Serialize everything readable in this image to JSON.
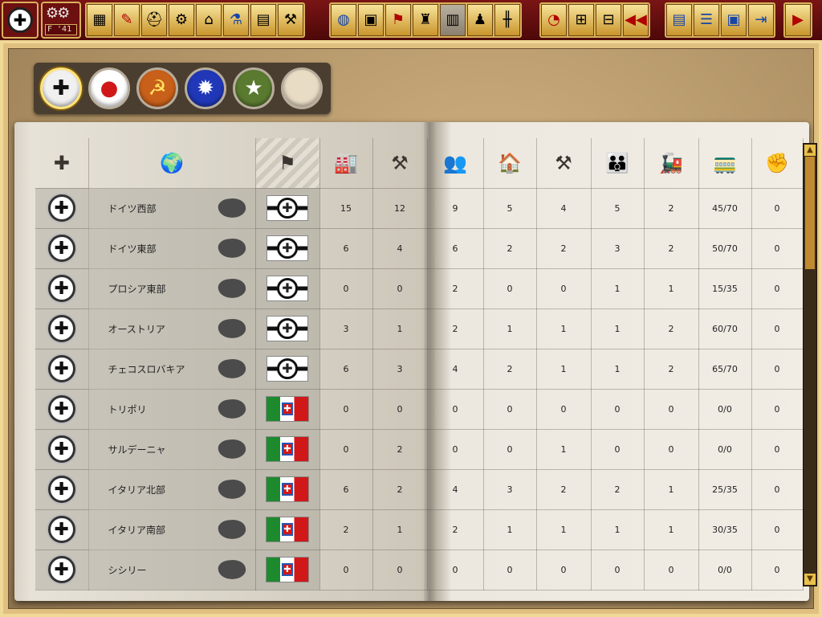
{
  "toolbar": {
    "main_icon": "balkenkreuz-icon",
    "date_label": "F '41",
    "icons": [
      "map-grid-icon",
      "production-icon",
      "helmet-icon",
      "tank-icon",
      "factory-icon",
      "research-icon",
      "building-icon",
      "tools-icon",
      "globe-icon",
      "document-globe-icon",
      "diplomacy-flag-icon",
      "army-icon",
      "industry-dim-icon",
      "troops-icon",
      "railroad-icon",
      "pie-chart-icon",
      "table-add-icon",
      "table-icon",
      "rewind-icon",
      "report-icon",
      "list-icon",
      "save-icon",
      "exit-icon",
      "next-icon"
    ]
  },
  "nations": [
    {
      "id": "germany",
      "symbol": "✚",
      "bg": "#f0f0f0",
      "fg": "#111111",
      "selected": true
    },
    {
      "id": "japan",
      "symbol": "●",
      "bg": "#ffffff",
      "fg": "#d01818"
    },
    {
      "id": "ussr",
      "symbol": "☭",
      "bg": "#c8601a",
      "fg": "#ffe060"
    },
    {
      "id": "china",
      "symbol": "✹",
      "bg": "#2038b8",
      "fg": "#ffffff"
    },
    {
      "id": "usa",
      "symbol": "★",
      "bg": "#5a7a30",
      "fg": "#ffffff"
    },
    {
      "id": "neutral",
      "symbol": "",
      "bg": "#e8dcc4",
      "fg": "#000000"
    }
  ],
  "header_icons": [
    "owner-icon",
    "world-map-icon",
    "flag-icon",
    "industry-icon",
    "resources-icon",
    "manpower-icon",
    "factory-small-icon",
    "pickaxe-hammer-icon",
    "people-icon",
    "train-icon",
    "transport-capacity-icon",
    "resistance-icon"
  ],
  "header_glyphs": [
    "✚",
    "🌍",
    "⚑",
    "🏭",
    "⚒",
    "👥",
    "🏠",
    "⚒",
    "👪",
    "🚂",
    "🚃",
    "✊"
  ],
  "regions": [
    {
      "name": "ドイツ西部",
      "flag": "de",
      "ic": "15",
      "res": "12",
      "mp": "9",
      "fac": "5",
      "mine": "4",
      "pop": "5",
      "rail": "2",
      "trans": "45/70",
      "resist": "0"
    },
    {
      "name": "ドイツ東部",
      "flag": "de",
      "ic": "6",
      "res": "4",
      "mp": "6",
      "fac": "2",
      "mine": "2",
      "pop": "3",
      "rail": "2",
      "trans": "50/70",
      "resist": "0"
    },
    {
      "name": "プロシア東部",
      "flag": "de",
      "ic": "0",
      "res": "0",
      "mp": "2",
      "fac": "0",
      "mine": "0",
      "pop": "1",
      "rail": "1",
      "trans": "15/35",
      "resist": "0"
    },
    {
      "name": "オーストリア",
      "flag": "de",
      "ic": "3",
      "res": "1",
      "mp": "2",
      "fac": "1",
      "mine": "1",
      "pop": "1",
      "rail": "2",
      "trans": "60/70",
      "resist": "0"
    },
    {
      "name": "チェコスロバキア",
      "flag": "de",
      "ic": "6",
      "res": "3",
      "mp": "4",
      "fac": "2",
      "mine": "1",
      "pop": "1",
      "rail": "2",
      "trans": "65/70",
      "resist": "0"
    },
    {
      "name": "トリポリ",
      "flag": "it",
      "ic": "0",
      "res": "0",
      "mp": "0",
      "fac": "0",
      "mine": "0",
      "pop": "0",
      "rail": "0",
      "trans": "0/0",
      "resist": "0"
    },
    {
      "name": "サルデーニャ",
      "flag": "it",
      "ic": "0",
      "res": "2",
      "mp": "0",
      "fac": "0",
      "mine": "1",
      "pop": "0",
      "rail": "0",
      "trans": "0/0",
      "resist": "0"
    },
    {
      "name": "イタリア北部",
      "flag": "it",
      "ic": "6",
      "res": "2",
      "mp": "4",
      "fac": "3",
      "mine": "2",
      "pop": "2",
      "rail": "1",
      "trans": "25/35",
      "resist": "0"
    },
    {
      "name": "イタリア南部",
      "flag": "it",
      "ic": "2",
      "res": "1",
      "mp": "2",
      "fac": "1",
      "mine": "1",
      "pop": "1",
      "rail": "1",
      "trans": "30/35",
      "resist": "0"
    },
    {
      "name": "シシリー",
      "flag": "it",
      "ic": "0",
      "res": "0",
      "mp": "0",
      "fac": "0",
      "mine": "0",
      "pop": "0",
      "rail": "0",
      "trans": "0/0",
      "resist": "0"
    }
  ]
}
